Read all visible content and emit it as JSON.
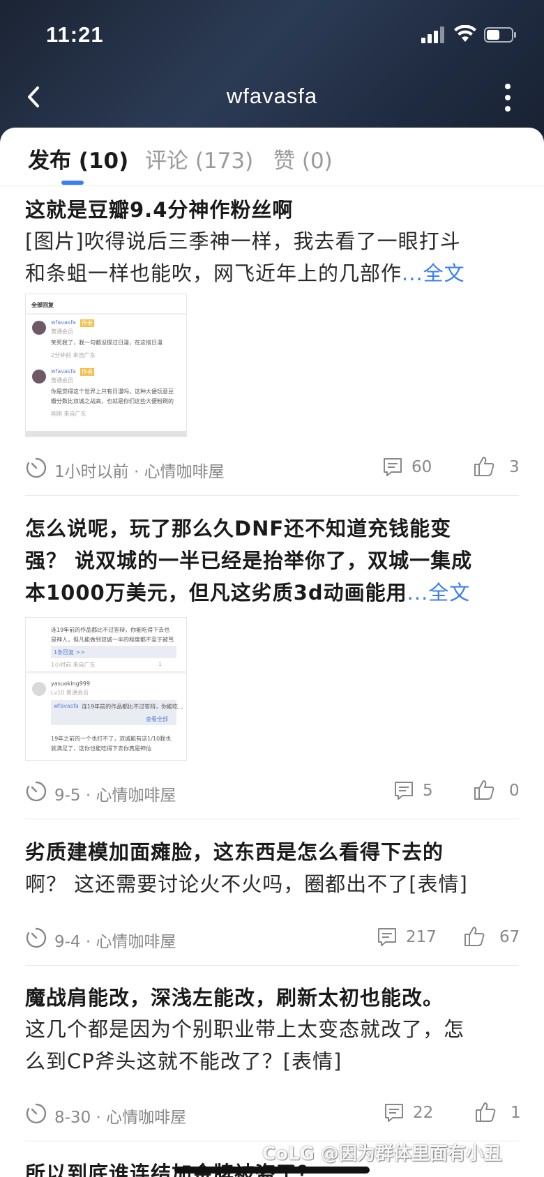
{
  "status_bar": {
    "time": "11:21"
  },
  "nav": {
    "title": "wfavasfa"
  },
  "tabs": [
    {
      "label": "发布 (10)",
      "active": true
    },
    {
      "label": "评论 (173)",
      "active": false
    },
    {
      "label": "赞 (0)",
      "active": false
    }
  ],
  "full_text_label": "...全文",
  "posts": [
    {
      "title": "这就是豆瓣9.4分神作粉丝啊",
      "body_lines": [
        "[图片]吹得说后三季神一样，我去看了一眼打斗",
        "和条蛆一样也能吹，网飞近年上的几部作"
      ],
      "time_source": "1小时以前 · 心情咖啡屋",
      "comments": "60",
      "likes": "3",
      "image": {
        "header": "全部回复",
        "user1": "wfavasfa",
        "badge1": "作者",
        "sub1": "普通会员",
        "text1": "笑死我了，我一句都没提过日漫，在这搭日漫",
        "meta1": "2分钟前 来自广东",
        "user2": "wfavasfa",
        "badge2": "作者",
        "sub2": "普通会员",
        "text2a": "你是觉得这个世界上只有日漫吗，这种大便玩意豆",
        "text2b": "瓣分数比双城之战高，也就是你们这些大便粉刷的",
        "meta2": "刚刚 来自广东"
      }
    },
    {
      "title_lines": [
        "怎么说呢，玩了那么久DNF还不知道充钱能变",
        "强？ 说双城的一半已经是抬举你了，双城一集成",
        "本1000万美元，但凡这劣质3d动画能用"
      ],
      "time_source": "9-5 · 心情咖啡屋",
      "comments": "5",
      "likes": "0",
      "image": {
        "text1a": "连19年前的作品都比不过答辩，你能吃得下去也",
        "text1b": "是神人，但凡能做到双城一半的程度都不至于被骂",
        "reply_count": "1条回复 >>",
        "meta1": "1小时前 来自广东",
        "like1": "1",
        "user2": "yasuoking999",
        "sub2": "Lv10 普通会员",
        "quote_user": "wfavasfa",
        "quote_text": "连19年前的作品都比不过答辩，你能吃...",
        "view_all": "查看全部",
        "text2a": "19年之前的一个也打不了，双城能有这1/10我也",
        "text2b": "就满足了，这你也能吃得下去你真是神仙"
      }
    },
    {
      "title_lines": [
        "劣质建模加面瘫脸，这东西是怎么看得下去的",
        "啊？ 这还需要讨论火不火吗，圈都出不了[表情]"
      ],
      "time_source": "9-4 · 心情咖啡屋",
      "comments": "217",
      "likes": "67"
    },
    {
      "title": "魔战肩能改，深浅左能改，刷新太初也能改。",
      "body_lines": [
        "这几个都是因为个别职业带上太变态就改了，怎",
        "么到CP斧头这就不能改了？[表情]"
      ],
      "time_source": "8-30 · 心情咖啡屋",
      "comments": "22",
      "likes": "1"
    },
    {
      "title": "所以到底谁连结加金牌被盗了？"
    }
  ],
  "watermark": "CoLG @因为群体里面有小丑"
}
